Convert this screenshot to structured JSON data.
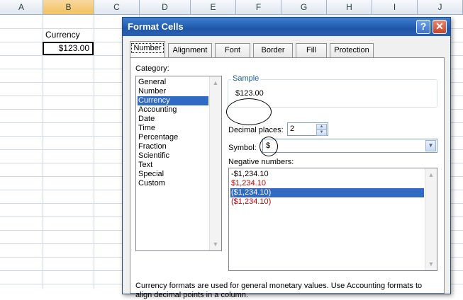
{
  "sheet": {
    "columns": [
      "A",
      "B",
      "C",
      "D",
      "E",
      "F",
      "G",
      "H",
      "I",
      "J"
    ],
    "selected_column": "B",
    "cells": {
      "b3": "Currency",
      "b4": "$123.00"
    }
  },
  "dialog": {
    "title": "Format Cells",
    "help_label": "?",
    "close_label": "✕",
    "tabs": [
      {
        "label": "Number"
      },
      {
        "label": "Alignment"
      },
      {
        "label": "Font"
      },
      {
        "label": "Border"
      },
      {
        "label": "Fill"
      },
      {
        "label": "Protection"
      }
    ],
    "active_tab": "Number",
    "category_label": "Category:",
    "categories": [
      "General",
      "Number",
      "Currency",
      "Accounting",
      "Date",
      "Time",
      "Percentage",
      "Fraction",
      "Scientific",
      "Text",
      "Special",
      "Custom"
    ],
    "selected_category": "Currency",
    "sample_label": "Sample",
    "sample_value": "$123.00",
    "decimal_label": "Decimal places:",
    "decimal_value": "2",
    "symbol_label": "Symbol:",
    "symbol_value": "$",
    "negative_label": "Negative numbers:",
    "negatives": [
      {
        "text": "-$1,234.10",
        "color": "#000000"
      },
      {
        "text": "$1,234.10",
        "color": "#c00000"
      },
      {
        "text": "($1,234.10)",
        "color": "#000000"
      },
      {
        "text": "($1,234.10)",
        "color": "#c00000"
      }
    ],
    "selected_negative_index": 2,
    "description_line1": "Currency formats are used for general monetary values.  Use Accounting formats to",
    "description_line2": "align decimal points in a column."
  }
}
